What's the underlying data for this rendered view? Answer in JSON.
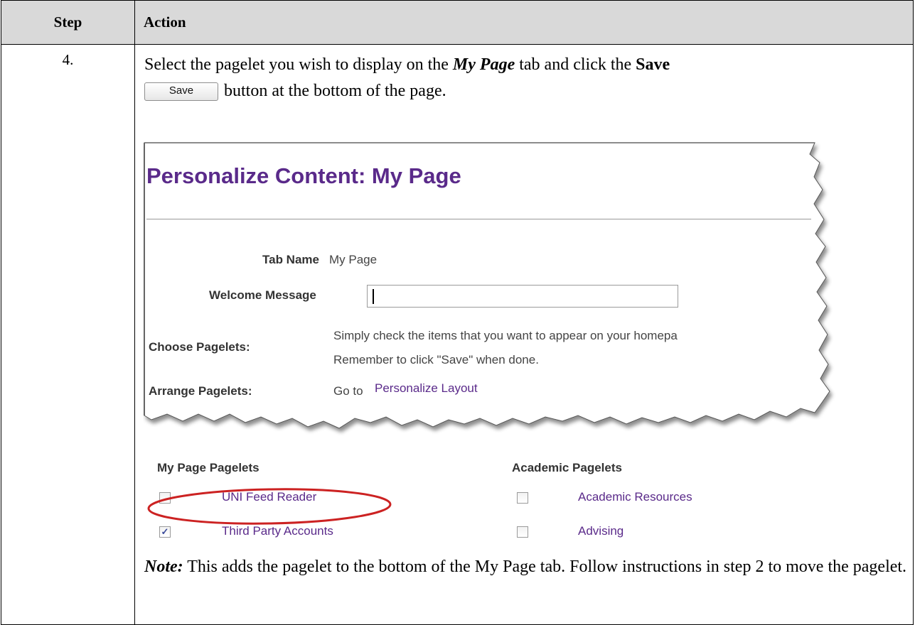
{
  "table": {
    "header": {
      "step": "Step",
      "action": "Action"
    },
    "step_number": "4.",
    "instruction": {
      "part1": "Select the pagelet you wish to display on the ",
      "my_page": "My Page",
      "part2": " tab and click the ",
      "save": "Save",
      "button_label": "Save",
      "part3": "button at the bottom of the page."
    },
    "note": {
      "label": "Note:",
      "text": " This adds the pagelet to the bottom of the My Page tab.  Follow instructions in step 2 to move the pagelet."
    }
  },
  "screenshot": {
    "title": "Personalize Content: My Page",
    "tab_name_label": "Tab Name",
    "tab_name_value": "My Page",
    "welcome_label": "Welcome Message",
    "welcome_value": "",
    "choose_label": "Choose Pagelets:",
    "choose_text1": "Simply check the items that you want to appear on your homepa",
    "choose_text2": "Remember to click \"Save\" when done.",
    "arrange_label": "Arrange Pagelets:",
    "arrange_goto": "Go to",
    "arrange_link": "Personalize Layout",
    "left_group": {
      "title": "My Page Pagelets",
      "items": [
        {
          "label": "UNI Feed Reader",
          "checked": false,
          "highlighted": true
        },
        {
          "label": "Third Party Accounts",
          "checked": true
        }
      ]
    },
    "right_group": {
      "title": "Academic Pagelets",
      "items": [
        {
          "label": "Academic Resources",
          "checked": false
        },
        {
          "label": "Advising",
          "checked": false
        }
      ]
    },
    "torn_edge_color": "#555555",
    "highlight_color": "#cc2222",
    "title_color": "#5a2a8a",
    "link_color": "#5a2a8a"
  }
}
